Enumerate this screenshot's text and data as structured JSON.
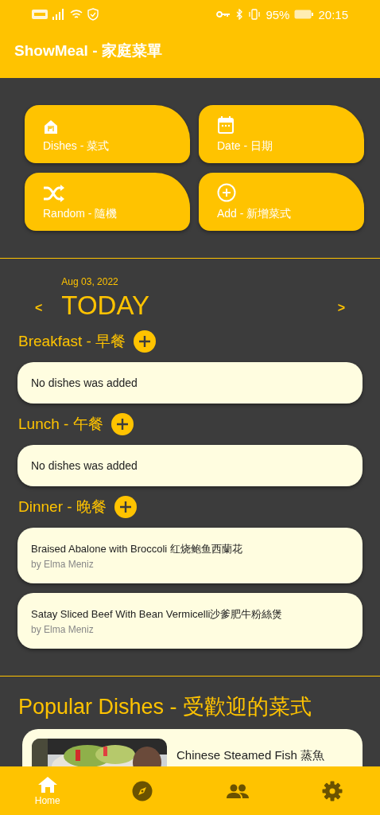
{
  "status_bar": {
    "battery": "95%",
    "time": "20:15"
  },
  "app_bar": {
    "title": "ShowMeal - 家庭菜單"
  },
  "quick_actions": [
    {
      "kind": "dishes",
      "label": "Dishes - 菜式"
    },
    {
      "kind": "date",
      "label": "Date - 日期"
    },
    {
      "kind": "random",
      "label": "Random - 隨機"
    },
    {
      "kind": "add",
      "label": "Add - 新增菜式"
    }
  ],
  "day": {
    "date": "Aug 03, 2022",
    "title": "TODAY",
    "prev": "<",
    "next": ">"
  },
  "meals": [
    {
      "title": "Breakfast - 早餐",
      "empty_text": "No dishes was added"
    },
    {
      "title": "Lunch - 午餐",
      "empty_text": "No dishes was added"
    },
    {
      "title": "Dinner - 晚餐",
      "dishes": [
        {
          "name": "Braised Abalone with Broccoli 红烧鲍鱼西蘭花",
          "author": "by Elma Meniz"
        },
        {
          "name": "Satay Sliced Beef With Bean Vermicelli沙爹肥牛粉絲煲",
          "author": "by Elma Meniz"
        }
      ]
    }
  ],
  "popular": {
    "title": "Popular Dishes - 受歡迎的菜式",
    "dishes": [
      {
        "kind": "picture",
        "name": "Chinese Steamed Fish 蒸魚"
      }
    ]
  },
  "bottom_nav": [
    {
      "kind": "home",
      "label": "Home",
      "selected": true
    },
    {
      "kind": "explore",
      "selected": false
    },
    {
      "kind": "people",
      "selected": false
    },
    {
      "kind": "settings",
      "selected": false
    }
  ]
}
